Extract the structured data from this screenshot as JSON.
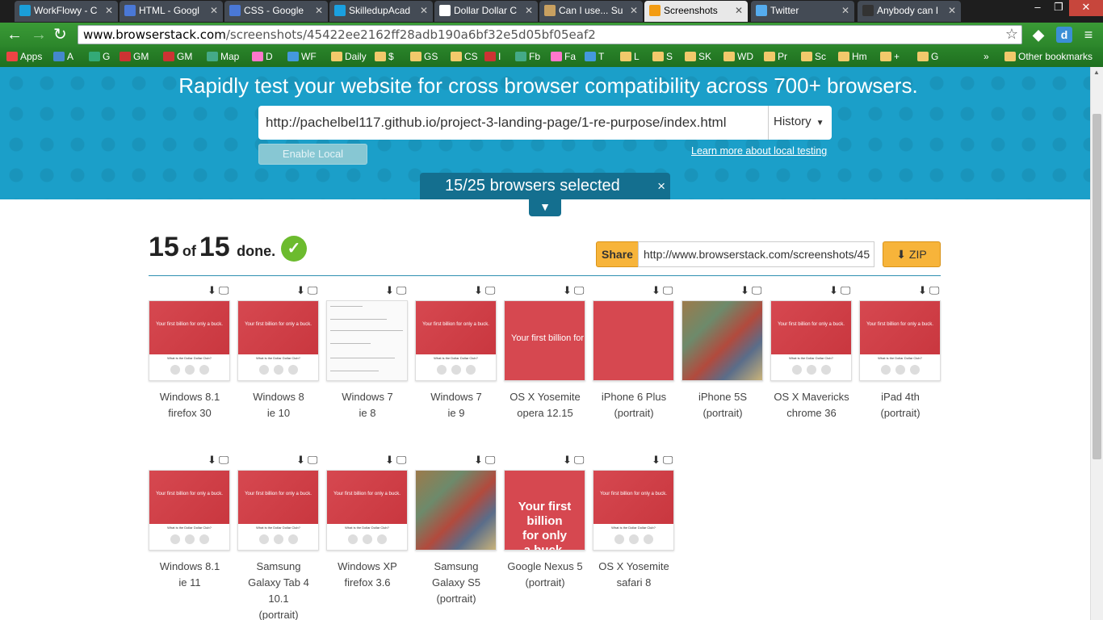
{
  "tabs": [
    {
      "label": "WorkFlowy - C",
      "color": "#1a9fd9"
    },
    {
      "label": "HTML - Googl",
      "color": "#4a78d6"
    },
    {
      "label": "CSS - Google",
      "color": "#4a78d6"
    },
    {
      "label": "SkilledupAcad",
      "color": "#1aa0e0"
    },
    {
      "label": "Dollar Dollar C",
      "color": "#ffffff"
    },
    {
      "label": "Can I use... Su",
      "color": "#c8a060"
    },
    {
      "label": "Screenshots",
      "color": "#f39c12"
    },
    {
      "label": "Twitter",
      "color": "#55acee"
    },
    {
      "label": "Anybody can I",
      "color": "#333333"
    }
  ],
  "address_bar": {
    "host": "www.browserstack.com",
    "path": "/screenshots/45422ee2162ff28adb190a6bf32e5d05bf05eaf2"
  },
  "bookmarks": [
    "Apps",
    "A",
    "G",
    "GM",
    "GM",
    "Map",
    "D",
    "WF",
    "Daily",
    "$",
    "GS",
    "CS",
    "I",
    "Fb",
    "Fa",
    "T",
    "L",
    "S",
    "SK",
    "WD",
    "Pr",
    "Sc",
    "Hm",
    "+",
    "G"
  ],
  "bookmarks_overflow": "»",
  "other_bookmarks": "Other bookmarks",
  "hero": {
    "title": "Rapidly test your website for cross browser compatibility across 700+ browsers.",
    "url": "http://pachelbel117.github.io/project-3-landing-page/1-re-purpose/index.html",
    "history_label": "History",
    "enable_local": "Enable Local",
    "learn_more": "Learn more about local testing",
    "selected_text": "15/25 browsers selected",
    "close_glyph": "×",
    "chevron_glyph": "⌄"
  },
  "results": {
    "done_count": "15",
    "of_word": "of",
    "total_count": "15",
    "done_word": "done.",
    "share_label": "Share",
    "share_url": "http://www.browserstack.com/screenshots/45",
    "zip_label": "ZIP"
  },
  "thumb_text": {
    "headline": "Your first billion for only a buck.",
    "subhead": "What is the Dollar Dollar Club?"
  },
  "screenshots": [
    {
      "line1": "Windows 8.1",
      "line2": "firefox 30",
      "line3": "",
      "style": "site"
    },
    {
      "line1": "Windows 8",
      "line2": "ie 10",
      "line3": "",
      "style": "site"
    },
    {
      "line1": "Windows 7",
      "line2": "ie 8",
      "line3": "",
      "style": "white"
    },
    {
      "line1": "Windows 7",
      "line2": "ie 9",
      "line3": "",
      "style": "site"
    },
    {
      "line1": "OS X Yosemite",
      "line2": "opera 12.15",
      "line3": "",
      "style": "full"
    },
    {
      "line1": "iPhone 6 Plus",
      "line2": "(portrait)",
      "line3": "",
      "style": "red"
    },
    {
      "line1": "iPhone 5S",
      "line2": "(portrait)",
      "line3": "",
      "style": "money"
    },
    {
      "line1": "OS X Mavericks",
      "line2": "chrome 36",
      "line3": "",
      "style": "site"
    },
    {
      "line1": "iPad 4th",
      "line2": "(portrait)",
      "line3": "",
      "style": "tall"
    },
    {
      "line1": "Windows 8.1",
      "line2": "ie 11",
      "line3": "",
      "style": "site"
    },
    {
      "line1": "Samsung",
      "line2": "Galaxy Tab 4",
      "line3": "10.1",
      "line4": "(portrait)",
      "style": "tall"
    },
    {
      "line1": "Windows XP",
      "line2": "firefox 3.6",
      "line3": "",
      "style": "site"
    },
    {
      "line1": "Samsung",
      "line2": "Galaxy S5",
      "line3": "(portrait)",
      "style": "money"
    },
    {
      "line1": "Google Nexus 5",
      "line2": "(portrait)",
      "line3": "",
      "style": "big"
    },
    {
      "line1": "OS X Yosemite",
      "line2": "safari 8",
      "line3": "",
      "style": "short"
    }
  ],
  "colors": {
    "hero": "#1b9fc9",
    "pill": "#146f8f",
    "share": "#f7b43a",
    "check": "#6cbb2e",
    "thumb_red": "#d64850"
  }
}
